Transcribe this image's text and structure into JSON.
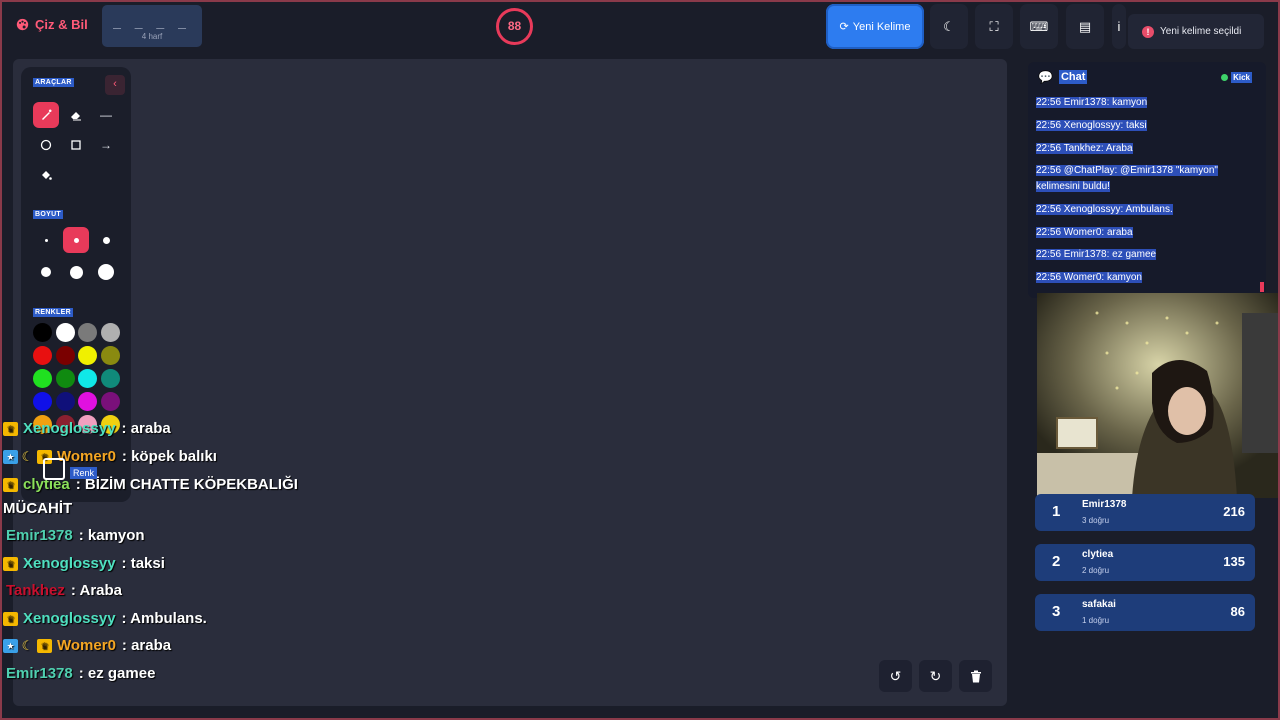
{
  "app": {
    "logo_text": "Çiz & Bil"
  },
  "word": {
    "dashes": "_ _ _ _",
    "length_label": "4 harf"
  },
  "timer": {
    "value": "88"
  },
  "toolbar": {
    "new_word_label": "Yeni Kelime"
  },
  "toast": {
    "icon": "!",
    "text": "Yeni kelime seçildi"
  },
  "tools_panel": {
    "tools_title": "ARAÇLAR",
    "size_title": "BOYUT",
    "colors_title": "RENKLER",
    "renk_tooltip": "Renk"
  },
  "colors": [
    "#000000",
    "#ffffff",
    "#7a7a7a",
    "#b0b0b0",
    "#e81010",
    "#7a0000",
    "#f0f000",
    "#8a8a10",
    "#20e020",
    "#108a10",
    "#10e8e8",
    "#108a7a",
    "#1010e8",
    "#10107a",
    "#e010e0",
    "#7a107a",
    "#f0a010",
    "#8a2030",
    "#f0a0c0",
    "#f0d010"
  ],
  "overlay_chat": [
    {
      "badges": [
        "crown"
      ],
      "user": "Xenoglossyy",
      "user_color": "#4fe0c0",
      "message": ": araba"
    },
    {
      "badges": [
        "star",
        "moon",
        "crown"
      ],
      "user": "Womer0",
      "user_color": "#f5a623",
      "message": ": köpek balıkı"
    },
    {
      "badges": [
        "crown"
      ],
      "user": "clytiea",
      "user_color": "#8be05a",
      "message": ": BİZİM CHATTE KÖPEKBALIĞI"
    },
    {
      "badges": [],
      "user": "",
      "user_color": "#ffffff",
      "message": "MÜCAHİT"
    },
    {
      "badges": [],
      "user": "Emir1378",
      "user_color": "#4fd0b0",
      "message": ": kamyon"
    },
    {
      "badges": [
        "crown"
      ],
      "user": "Xenoglossyy",
      "user_color": "#4fe0c0",
      "message": ": taksi"
    },
    {
      "badges": [],
      "user": "Tankhez",
      "user_color": "#c8102e",
      "message": ": Araba"
    },
    {
      "badges": [
        "crown"
      ],
      "user": "Xenoglossyy",
      "user_color": "#4fe0c0",
      "message": ": Ambulans."
    },
    {
      "badges": [
        "star",
        "moon",
        "crown"
      ],
      "user": "Womer0",
      "user_color": "#f5a623",
      "message": ": araba"
    },
    {
      "badges": [],
      "user": "Emir1378",
      "user_color": "#4fd0b0",
      "message": ": ez gamee"
    }
  ],
  "chat": {
    "title": "Chat",
    "platform": "Kick",
    "messages": [
      "22:56 Emir1378: kamyon",
      "22:56 Xenoglossyy: taksi",
      "22:56 Tankhez: Araba",
      "22:56 @ChatPlay: @Emir1378 \"kamyon\" kelimesini buldu!",
      "22:56 Xenoglossyy: Ambulans.",
      "22:56 Womer0: araba",
      "22:56 Emir1378: ez gamee",
      "22:56 Womer0: kamyon"
    ]
  },
  "leaderboard": [
    {
      "rank": "1",
      "name": "Emir1378",
      "correct": "3 doğru",
      "score": "216"
    },
    {
      "rank": "2",
      "name": "clytiea",
      "correct": "2 doğru",
      "score": "135"
    },
    {
      "rank": "3",
      "name": "safakai",
      "correct": "1 doğru",
      "score": "86"
    }
  ],
  "icons": {
    "logo": "palette-icon",
    "new_word": "refresh-icon",
    "theme": "moon-icon",
    "fullscreen": "fullscreen-icon",
    "keyboard": "keyboard-icon",
    "archive": "archive-icon",
    "info": "info-icon"
  }
}
